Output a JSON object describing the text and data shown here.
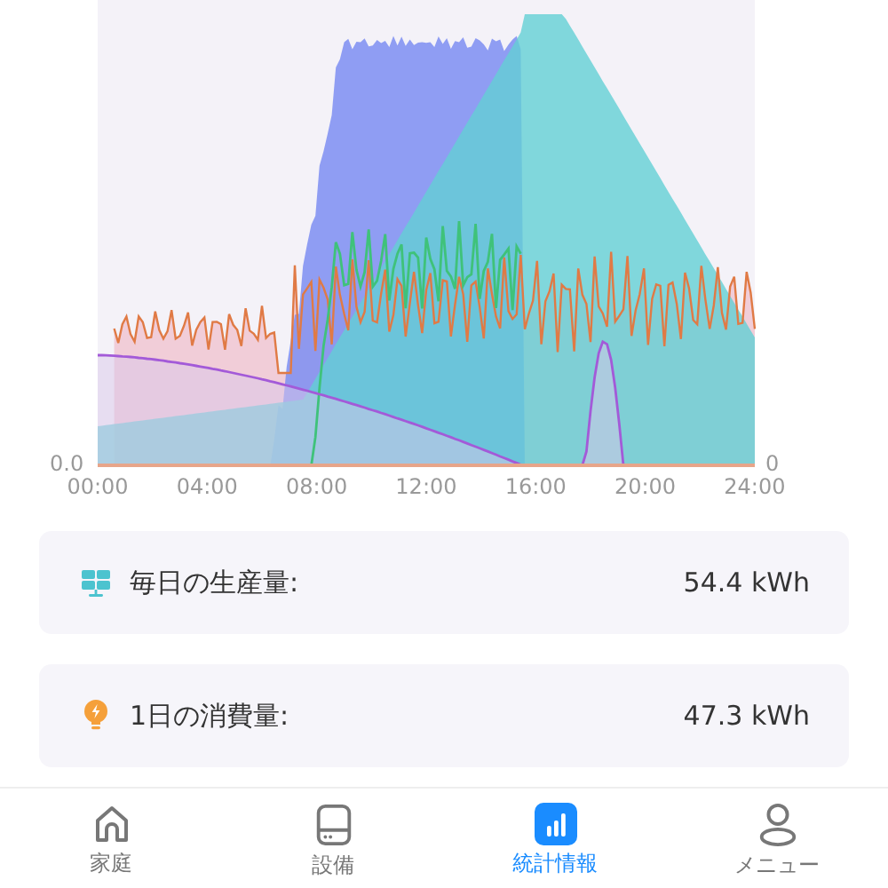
{
  "chart": {
    "y_left_label": "0.0",
    "y_right_label": "0",
    "x_labels": [
      "00:00",
      "04:00",
      "08:00",
      "12:00",
      "16:00",
      "20:00",
      "24:00"
    ]
  },
  "cards": [
    {
      "kind": "solar",
      "label": "毎日の生産量:",
      "value": "54.4 kWh"
    },
    {
      "kind": "bulb",
      "label": "1日の消費量:",
      "value": "47.3 kWh"
    }
  ],
  "tab_bar": [
    {
      "kind": "home",
      "label": "家庭",
      "selected": false
    },
    {
      "kind": "device",
      "label": "設備",
      "selected": false
    },
    {
      "kind": "stats",
      "label": "統計情報",
      "selected": true
    },
    {
      "kind": "person",
      "label": "メニュー",
      "selected": false
    }
  ]
}
